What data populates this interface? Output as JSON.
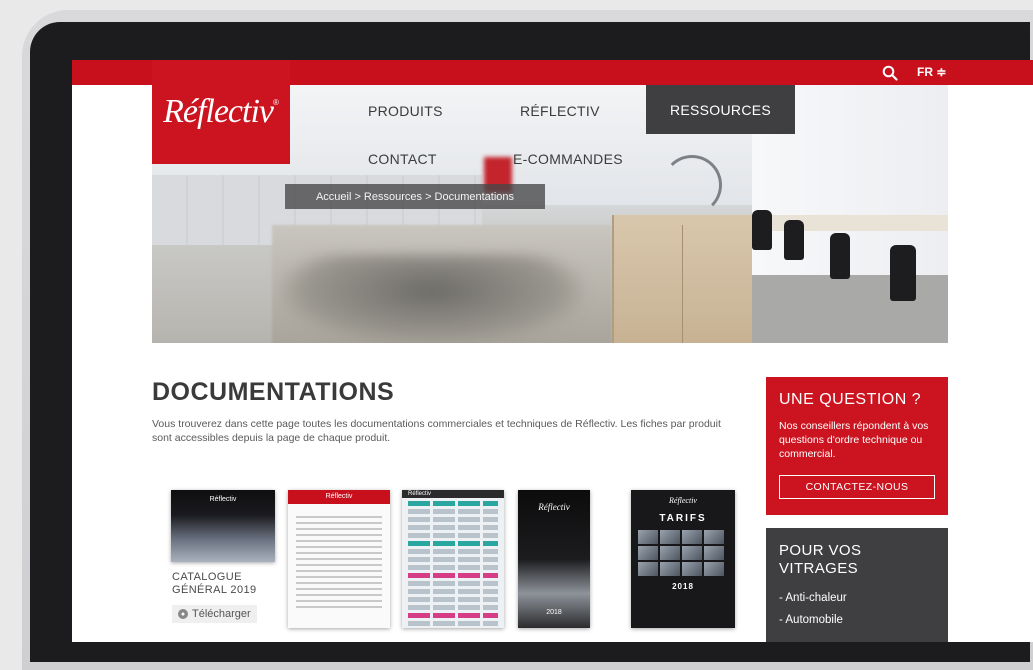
{
  "header": {
    "logo_text": "Réflectiv",
    "logo_mark": "®",
    "language": "FR ≑",
    "search_icon": "search-icon"
  },
  "nav": {
    "items": [
      {
        "label": "PRODUITS"
      },
      {
        "label": "RÉFLECTIV"
      },
      {
        "label": "RESSOURCES",
        "active": true
      },
      {
        "label": "CONTACT"
      },
      {
        "label": "E-COMMANDES"
      }
    ]
  },
  "breadcrumb": "Accueil > Ressources > Documentations",
  "main": {
    "title": "DOCUMENTATIONS",
    "intro": "Vous trouverez dans cette page toutes les documentations commerciales et techniques de Réflectiv. Les fiches par produit sont accessibles depuis la page de chaque produit.",
    "documents": [
      {
        "caption_line1": "CATALOGUE",
        "caption_line2": "GÉNÉRAL 2019",
        "download_label": "Télécharger",
        "cover_mark": "Réflectiv"
      },
      {
        "cover_mark": "Réflectiv"
      },
      {
        "cover_mark": "Réflectiv"
      },
      {
        "cover_mark": "Réflectiv",
        "year": "2018"
      },
      {
        "cover_mark": "Réflectiv",
        "cover_title": "TARIFS",
        "year": "2018"
      }
    ]
  },
  "sidebar": {
    "question": {
      "title": "UNE QUESTION ?",
      "text": "Nos conseillers répondent à vos questions d'ordre technique ou commercial.",
      "button": "CONTACTEZ-NOUS"
    },
    "vitrages": {
      "title_line1": "POUR VOS",
      "title_line2": "VITRAGES",
      "items": [
        "- Anti-chaleur",
        "- Automobile"
      ]
    }
  },
  "colors": {
    "brand_red": "#c8101d",
    "dark_gray": "#3f3f41"
  }
}
